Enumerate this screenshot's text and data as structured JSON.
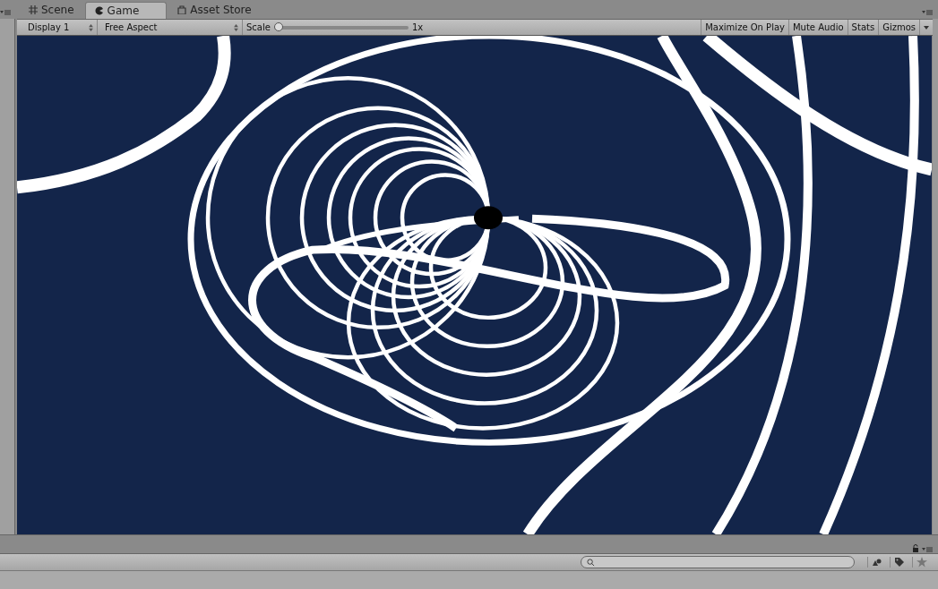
{
  "tabs": [
    {
      "label": "Scene",
      "selected": false
    },
    {
      "label": "Game",
      "selected": true
    },
    {
      "label": "Asset Store",
      "selected": false
    }
  ],
  "toolbar": {
    "display": "Display 1",
    "aspect": "Free Aspect",
    "scale": {
      "label": "Scale",
      "level": 0,
      "reading": "1x"
    },
    "buttons": [
      "Maximize On Play",
      "Mute Audio",
      "Stats",
      "Gizmos"
    ]
  }
}
